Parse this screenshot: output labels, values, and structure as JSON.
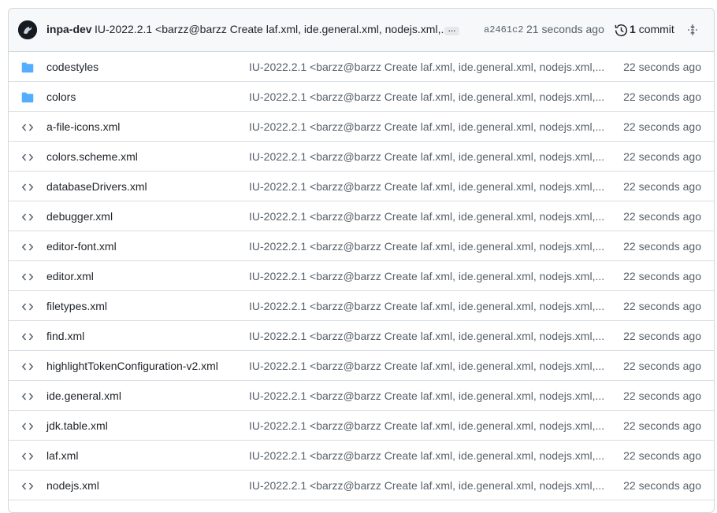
{
  "latest_commit": {
    "author": "inpa-dev",
    "message": "IU-2022.2.1 <barzz@barzz Create laf.xml, ide.general.xml, nodejs.xml,...",
    "more_label": "…",
    "sha": "a2461c2",
    "time": "21 seconds ago",
    "commit_count": "1",
    "commit_label": "commit"
  },
  "icons": {
    "directory": "folder-icon",
    "file": "code-file-icon",
    "history": "history-icon",
    "expand": "unfold-icon"
  },
  "colors": {
    "folder": "#54aeff",
    "file_icon": "#57606a"
  },
  "files": [
    {
      "name": "codestyles",
      "type": "directory",
      "message": "IU-2022.2.1 <barzz@barzz Create laf.xml, ide.general.xml, nodejs.xml,...",
      "time": "22 seconds ago"
    },
    {
      "name": "colors",
      "type": "directory",
      "message": "IU-2022.2.1 <barzz@barzz Create laf.xml, ide.general.xml, nodejs.xml,...",
      "time": "22 seconds ago"
    },
    {
      "name": "a-file-icons.xml",
      "type": "file",
      "message": "IU-2022.2.1 <barzz@barzz Create laf.xml, ide.general.xml, nodejs.xml,...",
      "time": "22 seconds ago"
    },
    {
      "name": "colors.scheme.xml",
      "type": "file",
      "message": "IU-2022.2.1 <barzz@barzz Create laf.xml, ide.general.xml, nodejs.xml,...",
      "time": "22 seconds ago"
    },
    {
      "name": "databaseDrivers.xml",
      "type": "file",
      "message": "IU-2022.2.1 <barzz@barzz Create laf.xml, ide.general.xml, nodejs.xml,...",
      "time": "22 seconds ago"
    },
    {
      "name": "debugger.xml",
      "type": "file",
      "message": "IU-2022.2.1 <barzz@barzz Create laf.xml, ide.general.xml, nodejs.xml,...",
      "time": "22 seconds ago"
    },
    {
      "name": "editor-font.xml",
      "type": "file",
      "message": "IU-2022.2.1 <barzz@barzz Create laf.xml, ide.general.xml, nodejs.xml,...",
      "time": "22 seconds ago"
    },
    {
      "name": "editor.xml",
      "type": "file",
      "message": "IU-2022.2.1 <barzz@barzz Create laf.xml, ide.general.xml, nodejs.xml,...",
      "time": "22 seconds ago"
    },
    {
      "name": "filetypes.xml",
      "type": "file",
      "message": "IU-2022.2.1 <barzz@barzz Create laf.xml, ide.general.xml, nodejs.xml,...",
      "time": "22 seconds ago"
    },
    {
      "name": "find.xml",
      "type": "file",
      "message": "IU-2022.2.1 <barzz@barzz Create laf.xml, ide.general.xml, nodejs.xml,...",
      "time": "22 seconds ago"
    },
    {
      "name": "highlightTokenConfiguration-v2.xml",
      "type": "file",
      "message": "IU-2022.2.1 <barzz@barzz Create laf.xml, ide.general.xml, nodejs.xml,...",
      "time": "22 seconds ago"
    },
    {
      "name": "ide.general.xml",
      "type": "file",
      "message": "IU-2022.2.1 <barzz@barzz Create laf.xml, ide.general.xml, nodejs.xml,...",
      "time": "22 seconds ago"
    },
    {
      "name": "jdk.table.xml",
      "type": "file",
      "message": "IU-2022.2.1 <barzz@barzz Create laf.xml, ide.general.xml, nodejs.xml,...",
      "time": "22 seconds ago"
    },
    {
      "name": "laf.xml",
      "type": "file",
      "message": "IU-2022.2.1 <barzz@barzz Create laf.xml, ide.general.xml, nodejs.xml,...",
      "time": "22 seconds ago"
    },
    {
      "name": "nodejs.xml",
      "type": "file",
      "message": "IU-2022.2.1 <barzz@barzz Create laf.xml, ide.general.xml, nodejs.xml,...",
      "time": "22 seconds ago"
    }
  ]
}
